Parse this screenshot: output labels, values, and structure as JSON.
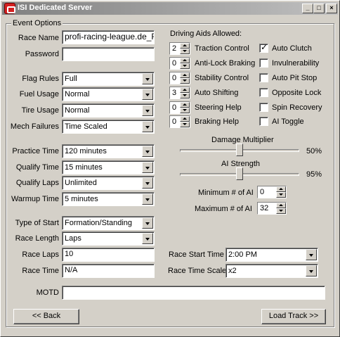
{
  "window": {
    "title": "ISI Dedicated Server"
  },
  "group_title": "Event Options",
  "fields": {
    "race_name": {
      "label": "Race Name",
      "value": "profi-racing-league.de_F1"
    },
    "password": {
      "label": "Password",
      "value": ""
    },
    "flag_rules": {
      "label": "Flag Rules",
      "value": "Full"
    },
    "fuel_usage": {
      "label": "Fuel Usage",
      "value": "Normal"
    },
    "tire_usage": {
      "label": "Tire Usage",
      "value": "Normal"
    },
    "mech_failures": {
      "label": "Mech Failures",
      "value": "Time Scaled"
    },
    "practice_time": {
      "label": "Practice Time",
      "value": "120 minutes"
    },
    "qualify_time": {
      "label": "Qualify Time",
      "value": "15 minutes"
    },
    "qualify_laps": {
      "label": "Qualify Laps",
      "value": "Unlimited"
    },
    "warmup_time": {
      "label": "Warmup Time",
      "value": "5 minutes"
    },
    "type_of_start": {
      "label": "Type of Start",
      "value": "Formation/Standing"
    },
    "race_length": {
      "label": "Race Length",
      "value": "Laps"
    },
    "race_laps": {
      "label": "Race Laps",
      "value": "10"
    },
    "race_time": {
      "label": "Race Time",
      "value": "N/A"
    },
    "race_start_time": {
      "label": "Race Start Time",
      "value": "2:00 PM"
    },
    "race_time_scale": {
      "label": "Race Time Scale",
      "value": "x2"
    },
    "motd": {
      "label": "MOTD",
      "value": ""
    }
  },
  "driving_aids": {
    "header": "Driving Aids Allowed:",
    "spinners": [
      {
        "label": "Traction Control",
        "value": "2"
      },
      {
        "label": "Anti-Lock Braking",
        "value": "0"
      },
      {
        "label": "Stability Control",
        "value": "0"
      },
      {
        "label": "Auto Shifting",
        "value": "3"
      },
      {
        "label": "Steering Help",
        "value": "0"
      },
      {
        "label": "Braking Help",
        "value": "0"
      }
    ],
    "checkboxes": [
      {
        "label": "Auto Clutch",
        "checked": true
      },
      {
        "label": "Invulnerability",
        "checked": false
      },
      {
        "label": "Auto Pit Stop",
        "checked": false
      },
      {
        "label": "Opposite Lock",
        "checked": false
      },
      {
        "label": "Spin Recovery",
        "checked": false
      },
      {
        "label": "AI Toggle",
        "checked": false
      }
    ]
  },
  "sliders": {
    "damage": {
      "label": "Damage Multiplier",
      "value_text": "50%",
      "fraction": 0.5
    },
    "ai_strength": {
      "label": "AI Strength",
      "value_text": "95%",
      "fraction": 0.5
    }
  },
  "ai_counts": {
    "min": {
      "label": "Minimum # of AI",
      "value": "0"
    },
    "max": {
      "label": "Maximum # of AI",
      "value": "32"
    }
  },
  "buttons": {
    "back": "<< Back",
    "load_track": "Load Track >>"
  },
  "titlebar_buttons": {
    "minimize": "_",
    "maximize": "□",
    "close": "×"
  }
}
